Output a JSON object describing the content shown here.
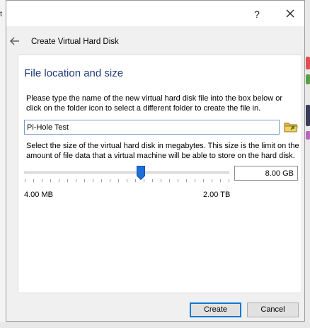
{
  "window": {
    "help_glyph": "?",
    "close_icon": "close-icon",
    "back_icon": "back-arrow-icon"
  },
  "header": {
    "title": "Create Virtual Hard Disk"
  },
  "section": {
    "title": "File location and size",
    "location_description": "Please type the name of the new virtual hard disk file into the box below or click on the folder icon to select a different folder to create the file in.",
    "size_description": "Select the size of the virtual hard disk in megabytes. This size is the limit on the amount of file data that a virtual machine will be able to store on the hard disk."
  },
  "file_name": {
    "value": "Pi-Hole Test",
    "folder_icon": "folder-icon"
  },
  "size": {
    "value": "8.00 GB",
    "min_label": "4.00 MB",
    "max_label": "2.00 TB",
    "slider_position": 0.57
  },
  "buttons": {
    "create": "Create",
    "cancel": "Cancel"
  },
  "colors": {
    "accent": "#0078d7",
    "section_title": "#1f3a7a",
    "slider_handle": "#1e6fd9",
    "folder": "#d9a520",
    "folder_arrow": "#3a9a2a"
  }
}
